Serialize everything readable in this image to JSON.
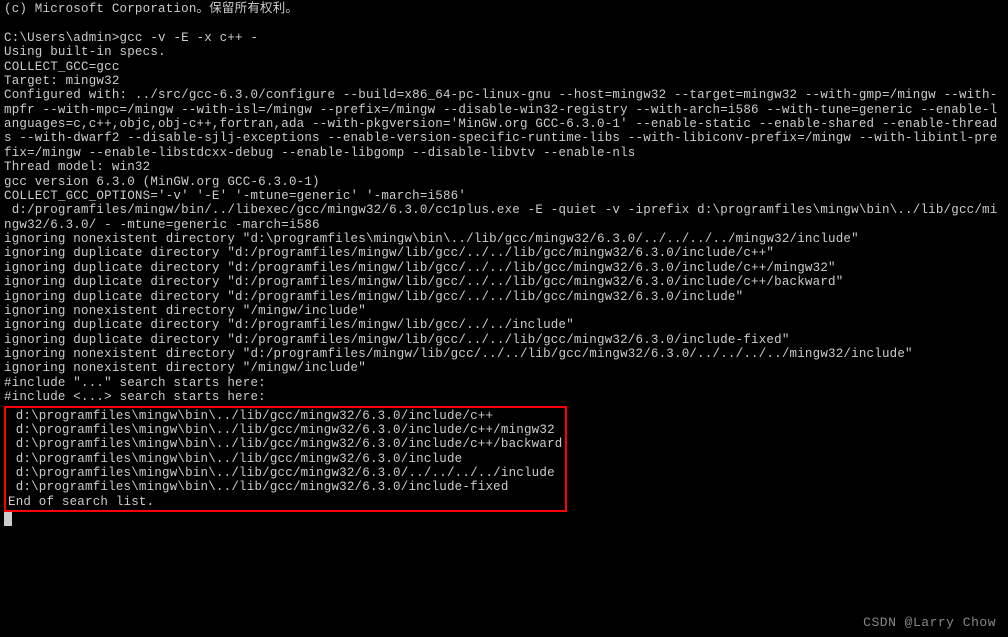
{
  "header": {
    "copyright": "(c) Microsoft Corporation。保留所有权利。"
  },
  "prompt": {
    "line": "C:\\Users\\admin>gcc -v -E -x c++ -"
  },
  "output": {
    "specs": "Using built-in specs.",
    "collect_gcc": "COLLECT_GCC=gcc",
    "target": "Target: mingw32",
    "configured": "Configured with: ../src/gcc-6.3.0/configure --build=x86_64-pc-linux-gnu --host=mingw32 --target=mingw32 --with-gmp=/mingw --with-mpfr --with-mpc=/mingw --with-isl=/mingw --prefix=/mingw --disable-win32-registry --with-arch=i586 --with-tune=generic --enable-languages=c,c++,objc,obj-c++,fortran,ada --with-pkgversion='MinGW.org GCC-6.3.0-1' --enable-static --enable-shared --enable-threads --with-dwarf2 --disable-sjlj-exceptions --enable-version-specific-runtime-libs --with-libiconv-prefix=/mingw --with-libintl-prefix=/mingw --enable-libstdcxx-debug --enable-libgomp --disable-libvtv --enable-nls",
    "thread_model": "Thread model: win32",
    "gcc_version": "gcc version 6.3.0 (MinGW.org GCC-6.3.0-1)",
    "collect_options": "COLLECT_GCC_OPTIONS='-v' '-E' '-mtune=generic' '-march=i586'",
    "cc1plus": " d:/programfiles/mingw/bin/../libexec/gcc/mingw32/6.3.0/cc1plus.exe -E -quiet -v -iprefix d:\\programfiles\\mingw\\bin\\../lib/gcc/mingw32/6.3.0/ - -mtune=generic -march=i586",
    "ignore_lines": [
      "ignoring nonexistent directory \"d:\\programfiles\\mingw\\bin\\../lib/gcc/mingw32/6.3.0/../../../../mingw32/include\"",
      "ignoring duplicate directory \"d:/programfiles/mingw/lib/gcc/../../lib/gcc/mingw32/6.3.0/include/c++\"",
      "ignoring duplicate directory \"d:/programfiles/mingw/lib/gcc/../../lib/gcc/mingw32/6.3.0/include/c++/mingw32\"",
      "ignoring duplicate directory \"d:/programfiles/mingw/lib/gcc/../../lib/gcc/mingw32/6.3.0/include/c++/backward\"",
      "ignoring duplicate directory \"d:/programfiles/mingw/lib/gcc/../../lib/gcc/mingw32/6.3.0/include\"",
      "ignoring nonexistent directory \"/mingw/include\"",
      "ignoring duplicate directory \"d:/programfiles/mingw/lib/gcc/../../include\"",
      "ignoring duplicate directory \"d:/programfiles/mingw/lib/gcc/../../lib/gcc/mingw32/6.3.0/include-fixed\"",
      "ignoring nonexistent directory \"d:/programfiles/mingw/lib/gcc/../../lib/gcc/mingw32/6.3.0/../../../../mingw32/include\"",
      "ignoring nonexistent directory \"/mingw/include\""
    ],
    "include_quote": "#include \"...\" search starts here:",
    "include_angle": "#include <...> search starts here:",
    "search_paths": [
      " d:\\programfiles\\mingw\\bin\\../lib/gcc/mingw32/6.3.0/include/c++",
      " d:\\programfiles\\mingw\\bin\\../lib/gcc/mingw32/6.3.0/include/c++/mingw32",
      " d:\\programfiles\\mingw\\bin\\../lib/gcc/mingw32/6.3.0/include/c++/backward",
      " d:\\programfiles\\mingw\\bin\\../lib/gcc/mingw32/6.3.0/include",
      " d:\\programfiles\\mingw\\bin\\../lib/gcc/mingw32/6.3.0/../../../../include",
      " d:\\programfiles\\mingw\\bin\\../lib/gcc/mingw32/6.3.0/include-fixed",
      "End of search list."
    ]
  },
  "watermark": "CSDN @Larry Chow"
}
